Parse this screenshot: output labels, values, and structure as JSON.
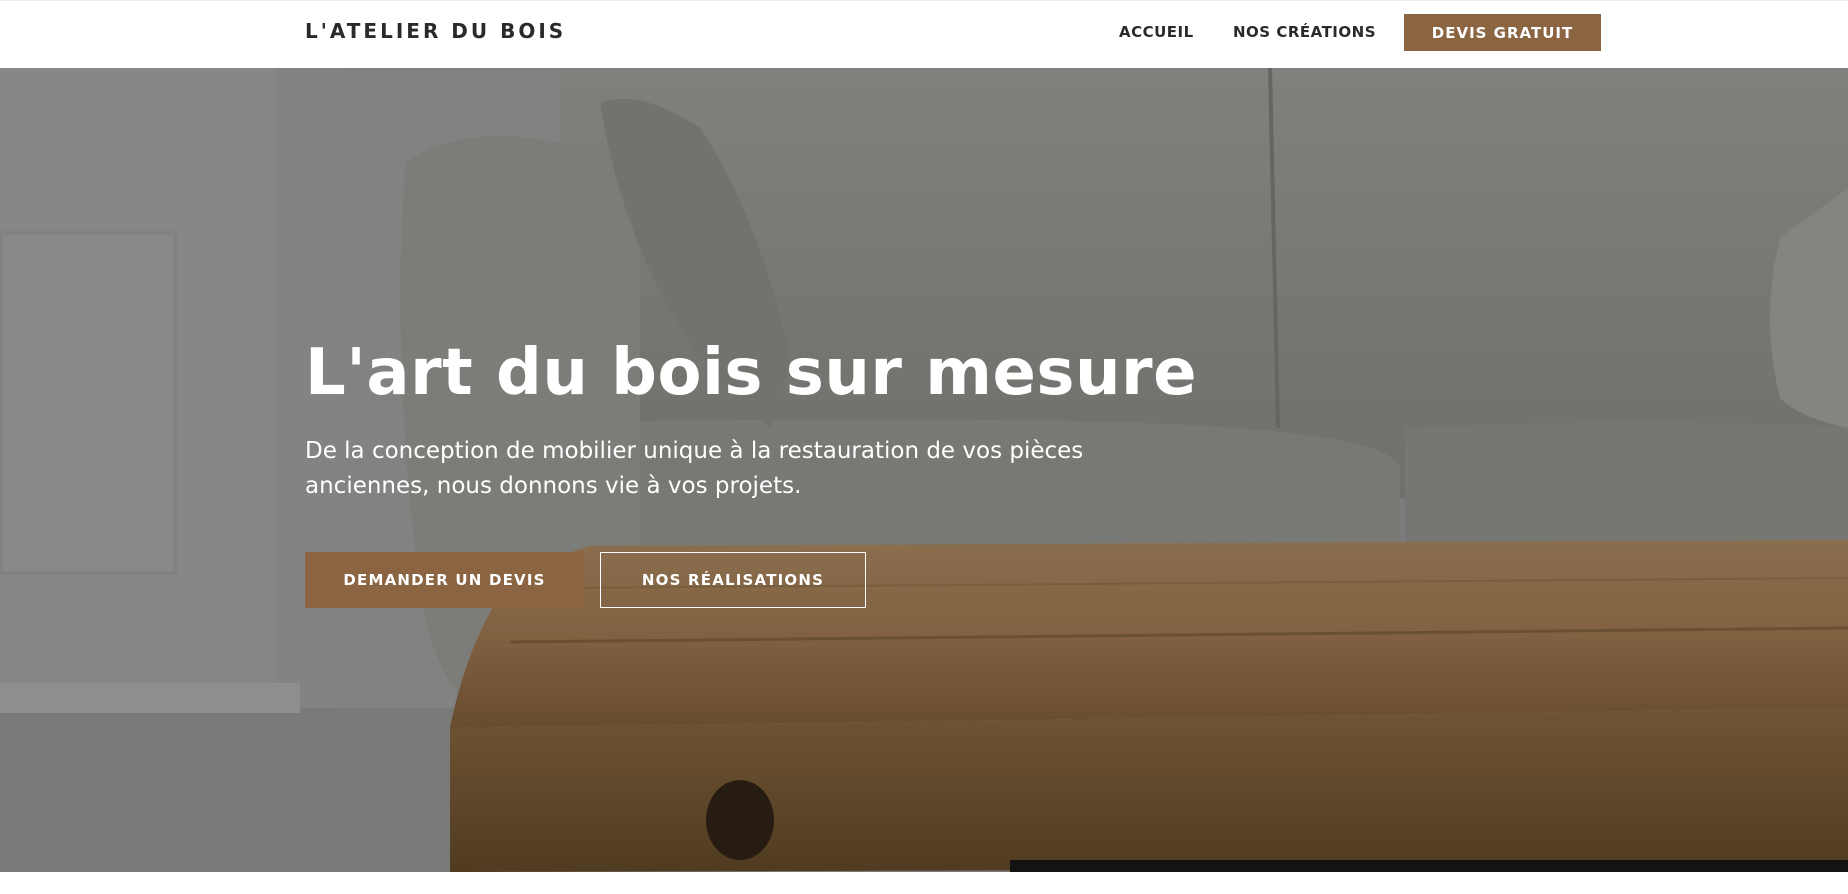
{
  "header": {
    "logo": "L'ATELIER DU BOIS",
    "nav": {
      "home": "ACCUEIL",
      "creations": "NOS CRÉATIONS",
      "cta": "DEVIS GRATUIT"
    }
  },
  "hero": {
    "title": "L'art du bois sur mesure",
    "subtitle": "De la conception de mobilier unique à la restauration de vos pièces anciennes, nous donnons vie à vos projets.",
    "primary_button": "DEMANDER UN DEVIS",
    "secondary_button": "NOS RÉALISATIONS"
  },
  "colors": {
    "accent": "#8b6441",
    "text_dark": "#2a2a2a",
    "hero_text": "#ffffff"
  }
}
